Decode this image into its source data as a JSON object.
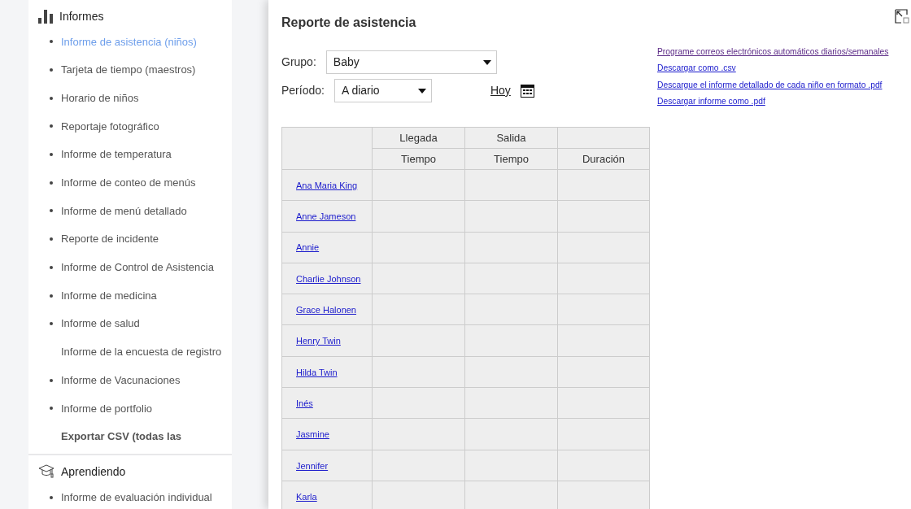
{
  "sidebar": {
    "sections": [
      {
        "title": "Informes",
        "items": [
          {
            "label": "Informe de asistencia (niños)",
            "kind": "bullet",
            "selected": true
          },
          {
            "label": "Tarjeta de tiempo (maestros)",
            "kind": "bullet",
            "selected": false
          },
          {
            "label": "Horario de niños",
            "kind": "bullet",
            "selected": false
          },
          {
            "label": "Reportaje fotográfico",
            "kind": "bullet",
            "selected": false
          },
          {
            "label": "Informe de temperatura",
            "kind": "bullet",
            "selected": false
          },
          {
            "label": "Informe de conteo de menús",
            "kind": "bullet",
            "selected": false
          },
          {
            "label": "Informe de menú detallado",
            "kind": "bullet",
            "selected": false
          },
          {
            "label": "Reporte de incidente",
            "kind": "bullet",
            "selected": false
          },
          {
            "label": "Informe de Control de Asistencia",
            "kind": "bullet",
            "selected": false
          },
          {
            "label": "Informe de medicina",
            "kind": "bullet",
            "selected": false
          },
          {
            "label": "Informe de salud",
            "kind": "bullet",
            "selected": false
          },
          {
            "label": "Informe de la encuesta de registro",
            "kind": "plain",
            "selected": false
          },
          {
            "label": "Informe de Vacunaciones",
            "kind": "bullet",
            "selected": false
          },
          {
            "label": "Informe de portfolio",
            "kind": "bullet",
            "selected": false
          },
          {
            "label": "Exportar CSV (todas las",
            "kind": "bold",
            "selected": false
          }
        ]
      },
      {
        "title": "Aprendiendo",
        "items": [
          {
            "label": "Informe de evaluación individual",
            "kind": "bullet",
            "selected": false
          }
        ]
      }
    ]
  },
  "report": {
    "title": "Reporte de asistencia",
    "group": {
      "label": "Grupo:",
      "value": "Baby"
    },
    "period": {
      "label": "Período:",
      "value": "A diario"
    },
    "today_link": "Hoy",
    "links": [
      {
        "text": "Programe correos electrónicos automáticos diarios/semanales",
        "visited": true
      },
      {
        "text": "Descargar como .csv",
        "visited": false
      },
      {
        "text": "Descargue el informe detallado de cada niño en formato .pdf",
        "visited": false
      },
      {
        "text": "Descargar informe como .pdf",
        "visited": false
      }
    ],
    "table": {
      "header_groups": [
        "Llegada",
        "Salida"
      ],
      "columns": [
        "Tiempo",
        "Tiempo",
        "Duración"
      ],
      "rows": [
        "Ana Maria King",
        "Anne Jameson",
        "Annie",
        "Charlie Johnson",
        "Grace Halonen",
        "Henry Twin",
        "Hilda Twin",
        "Inés",
        "Jasmine",
        "Jennifer",
        "Karla"
      ]
    }
  }
}
